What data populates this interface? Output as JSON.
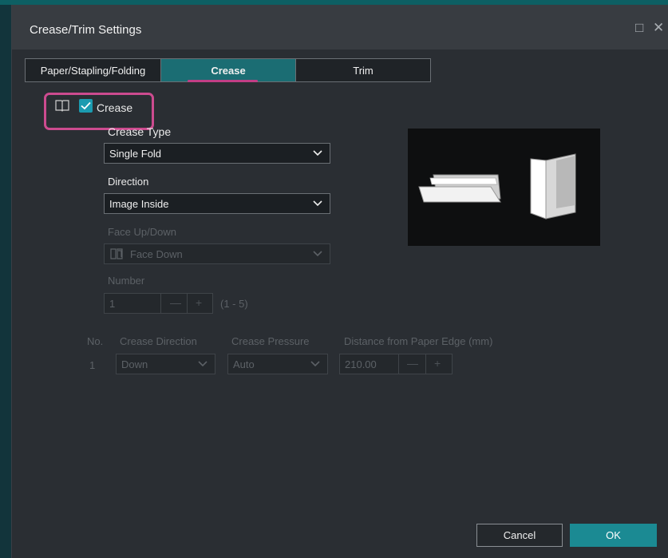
{
  "window": {
    "title": "Crease/Trim Settings"
  },
  "tabs": [
    {
      "label": "Paper/Stapling/Folding"
    },
    {
      "label": "Crease"
    },
    {
      "label": "Trim"
    }
  ],
  "crease": {
    "checkbox_label": "Crease",
    "checked": true,
    "type_label": "Crease Type",
    "type_value": "Single Fold",
    "direction_label": "Direction",
    "direction_value": "Image Inside",
    "face_label": "Face Up/Down",
    "face_value": "Face Down",
    "number_label": "Number",
    "number_value": "1",
    "number_range": "(1 - 5)"
  },
  "table": {
    "headers": {
      "no": "No.",
      "direction": "Crease Direction",
      "pressure": "Crease Pressure",
      "distance": "Distance from Paper Edge (mm)"
    },
    "rows": [
      {
        "no": "1",
        "direction": "Down",
        "pressure": "Auto",
        "distance": "210.00"
      }
    ]
  },
  "buttons": {
    "cancel": "Cancel",
    "ok": "OK"
  },
  "colors": {
    "accent": "#1b8a93",
    "highlight": "#cc4b8f",
    "tab_active": "#1b6d73"
  }
}
